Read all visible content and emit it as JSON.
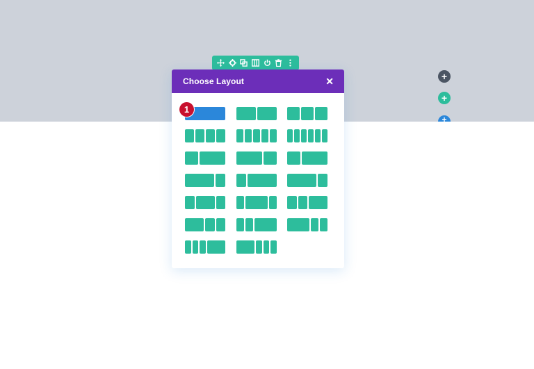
{
  "toolbar": {
    "icons": [
      "move-icon",
      "gear-icon",
      "duplicate-icon",
      "columns-icon",
      "power-icon",
      "trash-icon",
      "more-icon"
    ]
  },
  "side_buttons": {
    "dark_label": "+",
    "teal_label": "+",
    "blue_label": "+"
  },
  "modal": {
    "title": "Choose Layout",
    "close_label": "✕"
  },
  "badge": {
    "label": "1"
  },
  "layouts": [
    [
      1
    ],
    [
      1,
      1
    ],
    [
      1,
      1,
      1
    ],
    [
      1,
      1,
      1,
      1
    ],
    [
      1,
      1,
      1,
      1,
      1
    ],
    [
      1,
      1,
      1,
      1,
      1,
      1
    ],
    [
      1,
      2
    ],
    [
      2,
      1
    ],
    [
      1,
      2
    ],
    [
      3,
      1
    ],
    [
      1,
      3
    ],
    [
      3,
      1
    ],
    [
      1,
      2,
      1
    ],
    [
      1,
      3,
      1
    ],
    [
      1,
      1,
      2
    ],
    [
      2,
      1,
      1
    ],
    [
      1,
      1,
      3
    ],
    [
      3,
      1,
      1
    ],
    [
      1,
      1,
      1,
      3
    ],
    [
      3,
      1,
      1,
      1
    ]
  ],
  "selected_layout_index": 0,
  "colors": {
    "header": "#6c2eb9",
    "toolbar": "#2dbd9c",
    "layout_block": "#2dbd9c",
    "selected_block": "#2b87da",
    "badge": "#c8102e",
    "top_band": "#cdd2da"
  }
}
